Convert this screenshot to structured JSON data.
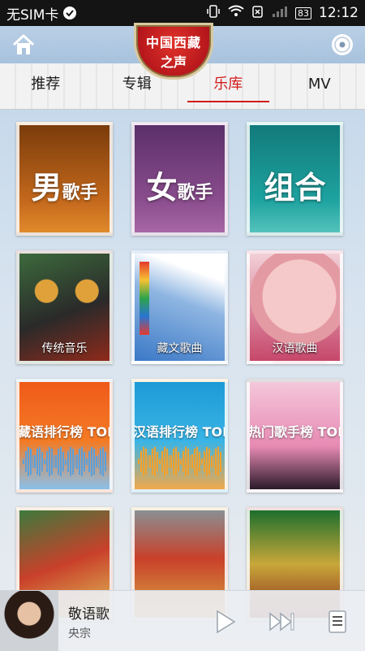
{
  "status": {
    "carrier": "无SIM卡",
    "battery": "83",
    "time": "12:12"
  },
  "header": {
    "logo_line1": "中国西藏",
    "logo_line2": "之声"
  },
  "tabs": [
    "推荐",
    "专辑",
    "乐库",
    "MV"
  ],
  "active_tab": 2,
  "tiles": [
    {
      "label_big": "男",
      "label_small": "歌手"
    },
    {
      "label_big": "女",
      "label_small": "歌手"
    },
    {
      "label_big": "组合",
      "label_small": ""
    },
    {
      "caption": "传统音乐"
    },
    {
      "caption": "藏文歌曲"
    },
    {
      "caption": "汉语歌曲"
    },
    {
      "chart_label": "藏语排行榜 TOP"
    },
    {
      "chart_label": "汉语排行榜 TOP"
    },
    {
      "chart_label": "热门歌手榜 TOP"
    },
    {
      "caption": ""
    },
    {
      "caption": ""
    },
    {
      "caption": ""
    }
  ],
  "player": {
    "title": "敬语歌",
    "artist": "央宗"
  },
  "icons": {
    "home": "home-icon",
    "disc": "disc-icon",
    "play": "play-icon",
    "next": "next-icon",
    "playlist": "playlist-icon"
  },
  "colors": {
    "accent": "#d21a1a",
    "status_bar": "#141414"
  }
}
